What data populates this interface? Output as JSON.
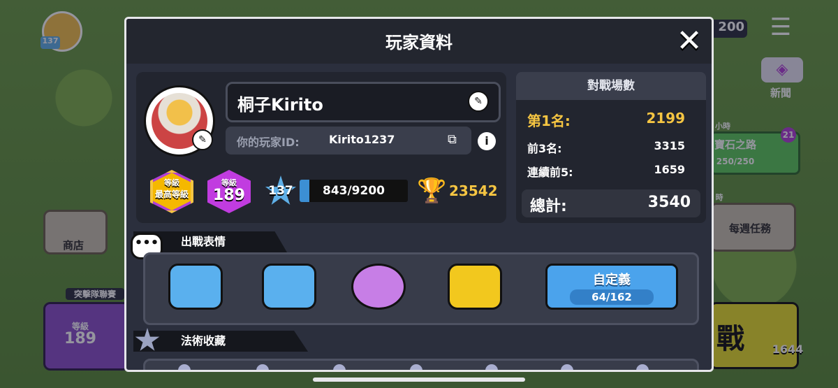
{
  "background": {
    "player_level": "137",
    "gem_count": "200",
    "news_label": "新聞",
    "shop_label": "商店",
    "road_title": "寶石之路",
    "road_hours": "小時",
    "road_badge": "21",
    "road_progress": "250/250",
    "weekly_hours": "時",
    "weekly_label": "每週任務",
    "league_label": "突擊隊聯賽",
    "league_level_label": "等級",
    "league_level_value": "189",
    "battle_label": "戰",
    "trophy_bg": "1644"
  },
  "modal": {
    "title": "玩家資料",
    "close_icon": "close-icon"
  },
  "profile": {
    "name": "桐子Kirito",
    "id_label": "你的玩家ID:",
    "id_value": "Kirito1237",
    "max_level_top": "等級",
    "max_level_bottom": "最高等級",
    "level_label": "等級",
    "level_value": "189",
    "xp_level": "137",
    "xp_progress": "843/9200",
    "xp_fraction": 0.0916,
    "trophies": "23542"
  },
  "battle_stats": {
    "title": "對戰場數",
    "rows": [
      {
        "label": "第1名:",
        "value": "2199"
      },
      {
        "label": "前3名:",
        "value": "3315"
      },
      {
        "label": "連續前5:",
        "value": "1659"
      }
    ],
    "total_label": "總計:",
    "total_value": "3540"
  },
  "emotes": {
    "section_title": "出戰表情",
    "bubble_icon": "chat-bubble-icon",
    "custom_label": "自定義",
    "custom_count": "64/162"
  },
  "spells": {
    "section_title": "法術收藏"
  },
  "colors": {
    "accent_blue": "#4ba3ec",
    "gold": "#f5c542",
    "purple": "#b13fd6",
    "panel": "#2b2f3d"
  }
}
